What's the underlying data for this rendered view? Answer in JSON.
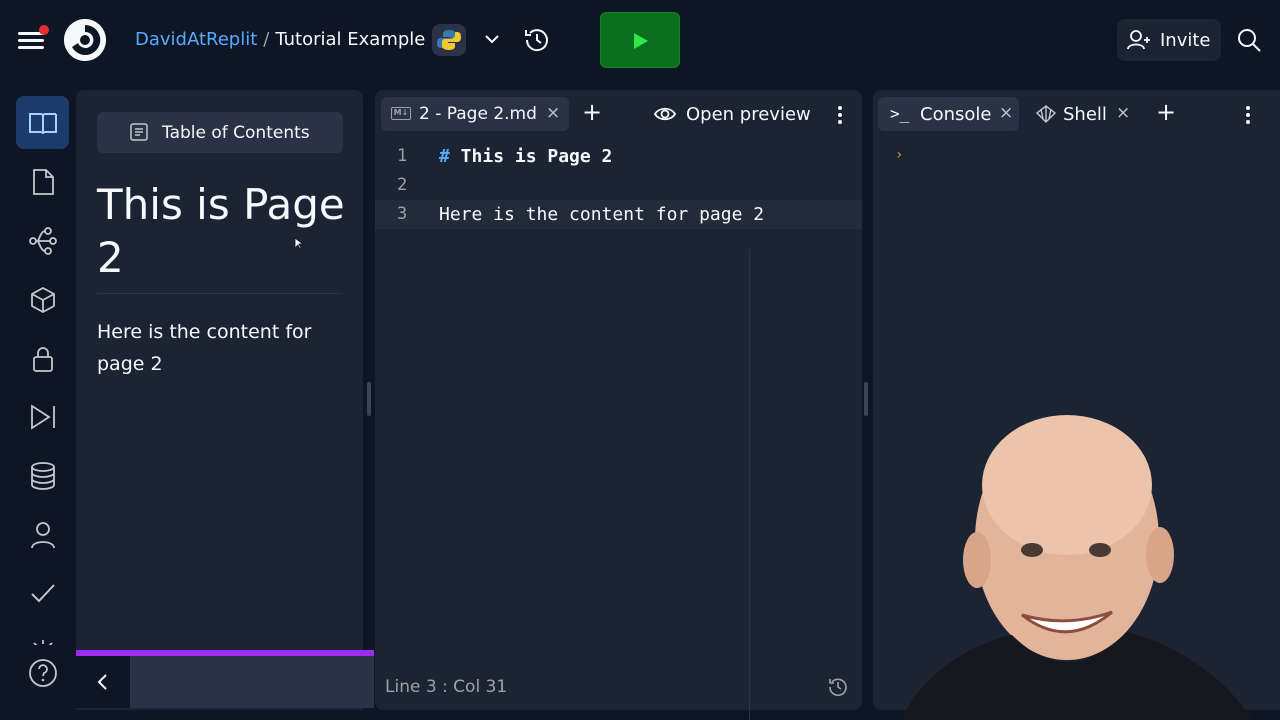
{
  "topbar": {
    "user": "DavidAtReplit",
    "separator": "/",
    "repl_name": "Tutorial Example",
    "language_icon": "python-icon",
    "invite_label": "Invite",
    "run_color": "#0a6e1f"
  },
  "sidebar": {
    "items": [
      {
        "icon": "docs-icon",
        "active": true
      },
      {
        "icon": "files-icon"
      },
      {
        "icon": "git-icon"
      },
      {
        "icon": "packages-icon"
      },
      {
        "icon": "secrets-icon"
      },
      {
        "icon": "debugger-icon"
      },
      {
        "icon": "database-icon"
      },
      {
        "icon": "user-icon"
      },
      {
        "icon": "checkmark-icon"
      },
      {
        "icon": "settings-icon"
      },
      {
        "icon": "help-icon"
      }
    ]
  },
  "docs": {
    "toc_label": "Table of Contents",
    "heading": "This is Page 2",
    "paragraph": "Here is the content for page 2",
    "accent": "#9b2cf0"
  },
  "editor": {
    "tab_label": "2 - Page 2.md",
    "tab_badge": "M↓",
    "preview_label": "Open preview",
    "lines": [
      {
        "num": "1",
        "hash": "#",
        "text": " This is Page 2"
      },
      {
        "num": "2",
        "text": ""
      },
      {
        "num": "3",
        "text": "Here is the content for page 2"
      }
    ],
    "status": "Line 3 : Col 31"
  },
  "console": {
    "console_tab": "Console",
    "console_glyph": ">_",
    "shell_tab": "Shell",
    "prompt": "›"
  },
  "close_glyph": "×",
  "plus_glyph": "+"
}
